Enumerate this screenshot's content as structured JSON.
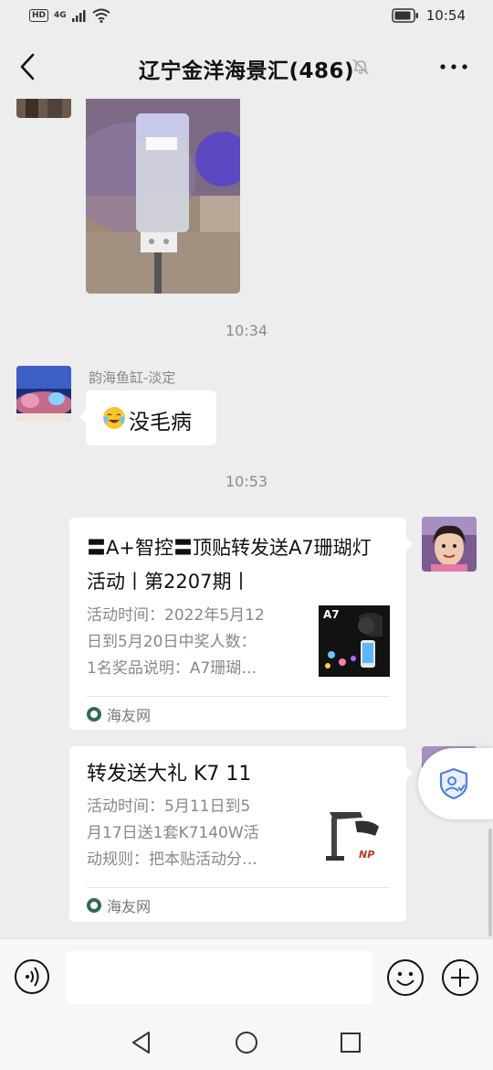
{
  "status_bar": {
    "hd": "HD",
    "network": "4G",
    "time": "10:54",
    "icons": [
      "signal-icon",
      "wifi-icon",
      "battery-icon"
    ]
  },
  "header": {
    "title": "辽宁金洋海景汇(486)",
    "icons": [
      "back-icon",
      "mute-bell-icon",
      "more-icon"
    ]
  },
  "chat": {
    "timestamps": [
      "10:34",
      "10:53"
    ],
    "message_text": {
      "sender": "韵海鱼缸-淡定",
      "text": "没毛病",
      "emoji": "laughing-crying-emoji"
    },
    "cards": [
      {
        "title": "〓A+智控〓顶贴转发送A7珊瑚灯活动丨第2207期丨",
        "desc_lines": [
          "活动时间：2022年5月12",
          "日到5月20日中奖人数：",
          "1名奖品说明：A7珊瑚…"
        ],
        "thumb_label": "A7",
        "source": "海友网"
      },
      {
        "title": "转发送大礼 K7 11",
        "desc_lines": [
          "活动时间：5月11日到5",
          "月17日送1套K7140W活",
          "动规则：把本贴活动分…"
        ],
        "thumb_label": "NP",
        "source": "海友网"
      }
    ]
  },
  "input_bar": {
    "value": "",
    "icons": [
      "voice-icon",
      "emoji-icon",
      "plus-icon"
    ]
  },
  "system_nav": {
    "icons": [
      "nav-back-icon",
      "nav-home-icon",
      "nav-recents-icon"
    ]
  },
  "colors": {
    "background": "#ededed",
    "bubble": "#ffffff",
    "meta_text": "#888888"
  }
}
